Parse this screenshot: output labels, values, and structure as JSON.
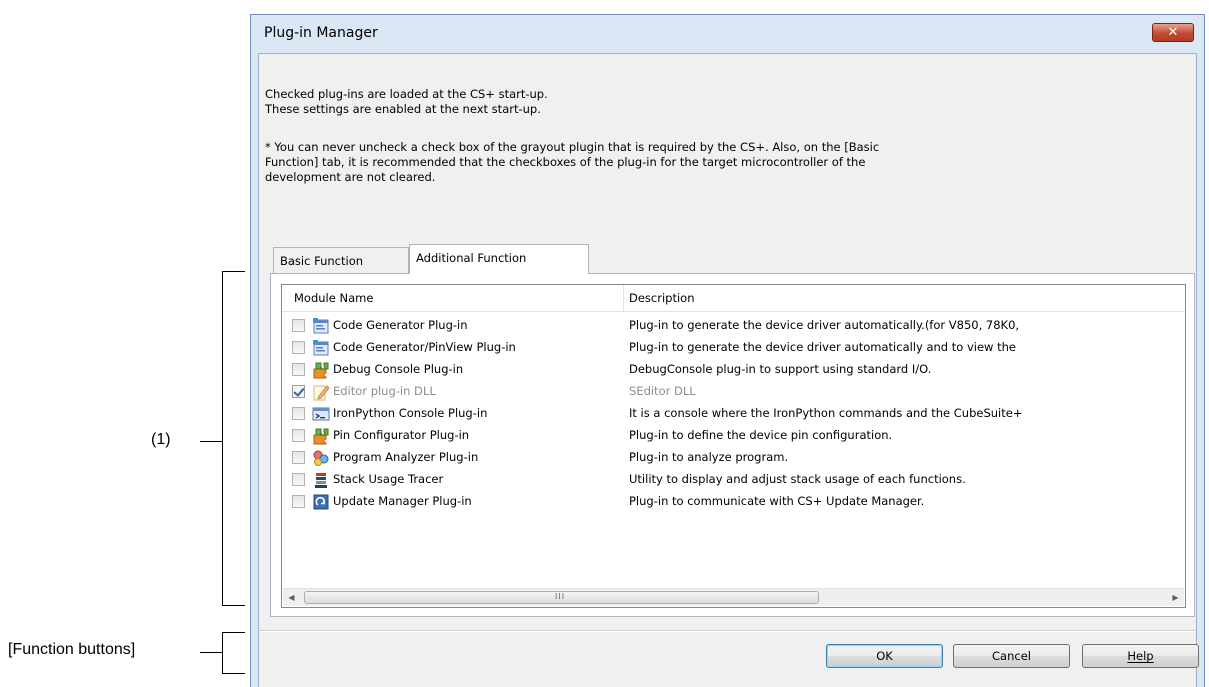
{
  "annotations": {
    "list_label": "(1)",
    "buttons_label": "[Function buttons]"
  },
  "dialog": {
    "title": "Plug-in Manager",
    "close_label": "✕",
    "info_lines": [
      "Checked plug-ins are loaded at the CS+ start-up.",
      "These settings are enabled at the next start-up."
    ],
    "note_lines": [
      "* You can never uncheck a check box of the grayout plugin that is required by the CS+. Also, on the [Basic",
      "Function] tab, it is recommended that the checkboxes of the plug-in for the target microcontroller of the",
      "development are not cleared."
    ],
    "tabs": [
      {
        "label": "Basic Function",
        "active": false
      },
      {
        "label": "Additional Function",
        "active": true
      }
    ],
    "columns": {
      "name": "Module Name",
      "description": "Description"
    },
    "rows": [
      {
        "checked": false,
        "disabled": false,
        "icon": "code-generator-icon",
        "name": "Code Generator Plug-in",
        "description": "Plug-in to generate the device driver automatically.(for V850, 78K0,"
      },
      {
        "checked": false,
        "disabled": false,
        "icon": "code-generator-icon",
        "name": "Code Generator/PinView Plug-in",
        "description": "Plug-in to generate the device driver automatically and to view the"
      },
      {
        "checked": false,
        "disabled": false,
        "icon": "puzzle-icon",
        "name": "Debug Console Plug-in",
        "description": "DebugConsole plug-in to support using standard I/O."
      },
      {
        "checked": true,
        "disabled": true,
        "icon": "pencil-icon",
        "name": "Editor plug-in DLL",
        "description": "SEditor DLL"
      },
      {
        "checked": false,
        "disabled": false,
        "icon": "console-icon",
        "name": "IronPython Console Plug-in",
        "description": "It is a console where the IronPython commands and the CubeSuite+"
      },
      {
        "checked": false,
        "disabled": false,
        "icon": "puzzle-icon",
        "name": "Pin Configurator Plug-in",
        "description": "Plug-in to define the device pin configuration."
      },
      {
        "checked": false,
        "disabled": false,
        "icon": "analyzer-icon",
        "name": "Program Analyzer Plug-in",
        "description": "Plug-in to analyze program."
      },
      {
        "checked": false,
        "disabled": false,
        "icon": "stack-icon",
        "name": "Stack Usage Tracer",
        "description": "Utility to display and adjust stack usage of each functions."
      },
      {
        "checked": false,
        "disabled": false,
        "icon": "update-icon",
        "name": "Update Manager Plug-in",
        "description": "Plug-in to communicate with CS+ Update Manager."
      }
    ],
    "scrollbar": {
      "left_arrow": "◀",
      "right_arrow": "▶",
      "grip": "III"
    },
    "buttons": {
      "ok": "OK",
      "cancel": "Cancel",
      "help": "Help"
    }
  }
}
